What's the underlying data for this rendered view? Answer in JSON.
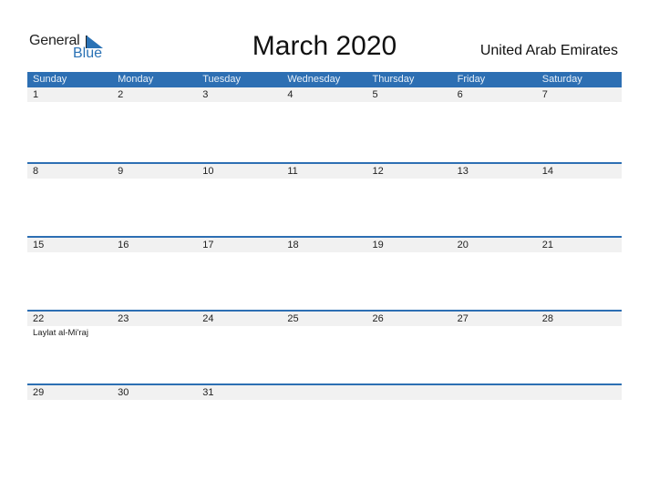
{
  "logo": {
    "general": "General",
    "blue": "Blue"
  },
  "title": "March 2020",
  "country": "United Arab Emirates",
  "colors": {
    "accent": "#2d6fb3",
    "day_strip": "#f1f1f1"
  },
  "weekdays": [
    "Sunday",
    "Monday",
    "Tuesday",
    "Wednesday",
    "Thursday",
    "Friday",
    "Saturday"
  ],
  "weeks": [
    {
      "days": [
        "1",
        "2",
        "3",
        "4",
        "5",
        "6",
        "7"
      ],
      "events": [
        "",
        "",
        "",
        "",
        "",
        "",
        ""
      ]
    },
    {
      "days": [
        "8",
        "9",
        "10",
        "11",
        "12",
        "13",
        "14"
      ],
      "events": [
        "",
        "",
        "",
        "",
        "",
        "",
        ""
      ]
    },
    {
      "days": [
        "15",
        "16",
        "17",
        "18",
        "19",
        "20",
        "21"
      ],
      "events": [
        "",
        "",
        "",
        "",
        "",
        "",
        ""
      ]
    },
    {
      "days": [
        "22",
        "23",
        "24",
        "25",
        "26",
        "27",
        "28"
      ],
      "events": [
        "Laylat al-Mi'raj",
        "",
        "",
        "",
        "",
        "",
        ""
      ]
    },
    {
      "days": [
        "29",
        "30",
        "31",
        "",
        "",
        "",
        ""
      ],
      "events": [
        "",
        "",
        "",
        "",
        "",
        "",
        ""
      ]
    }
  ]
}
